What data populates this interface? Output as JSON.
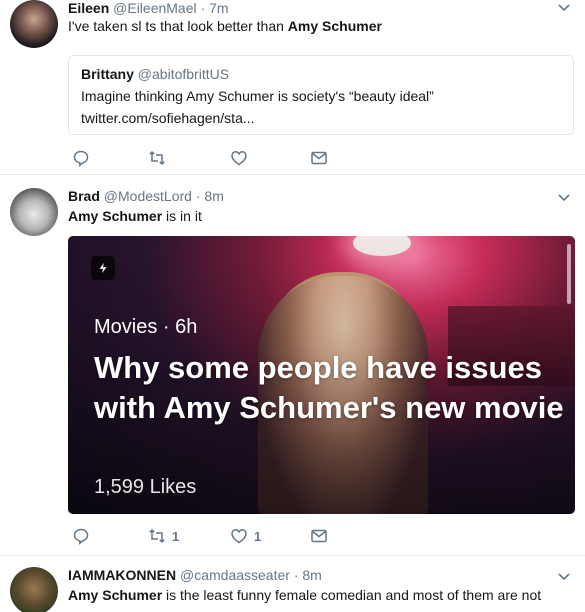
{
  "tweets": [
    {
      "name": "Eileen",
      "handle": "@EileenMael",
      "dot": "·",
      "time": "7m",
      "text_pre": "I've taken sl  ts that look better than ",
      "text_bold": "Amy Schumer",
      "quote": {
        "name": "Brittany",
        "handle": "@abitofbrittUS",
        "text": "Imagine thinking Amy Schumer is society's “beauty ideal”",
        "link": "twitter.com/sofiehagen/sta..."
      }
    },
    {
      "name": "Brad",
      "handle": "@ModestLord",
      "dot": "·",
      "time": "8m",
      "text_bold": "Amy Schumer",
      "text_post": " is in it",
      "card": {
        "category": "Movies · 6h",
        "headline": "Why some people have issues with Amy Schumer's new movie",
        "likes": "1,599 Likes"
      },
      "actions": {
        "retweets": "1",
        "likes": "1"
      }
    },
    {
      "name": "IAMMAKONNEN",
      "handle": "@camdaasseater",
      "dot": "·",
      "time": "8m",
      "text_bold": "Amy Schumer",
      "text_post": " is the least funny female comedian and most of them are not"
    }
  ],
  "colors": {
    "text": "#14171a",
    "secondary": "#657786",
    "border": "#e6ecf0"
  },
  "icons": [
    "reply-icon",
    "retweet-icon",
    "like-icon",
    "message-icon",
    "chevron-down-icon",
    "lightning-icon"
  ]
}
